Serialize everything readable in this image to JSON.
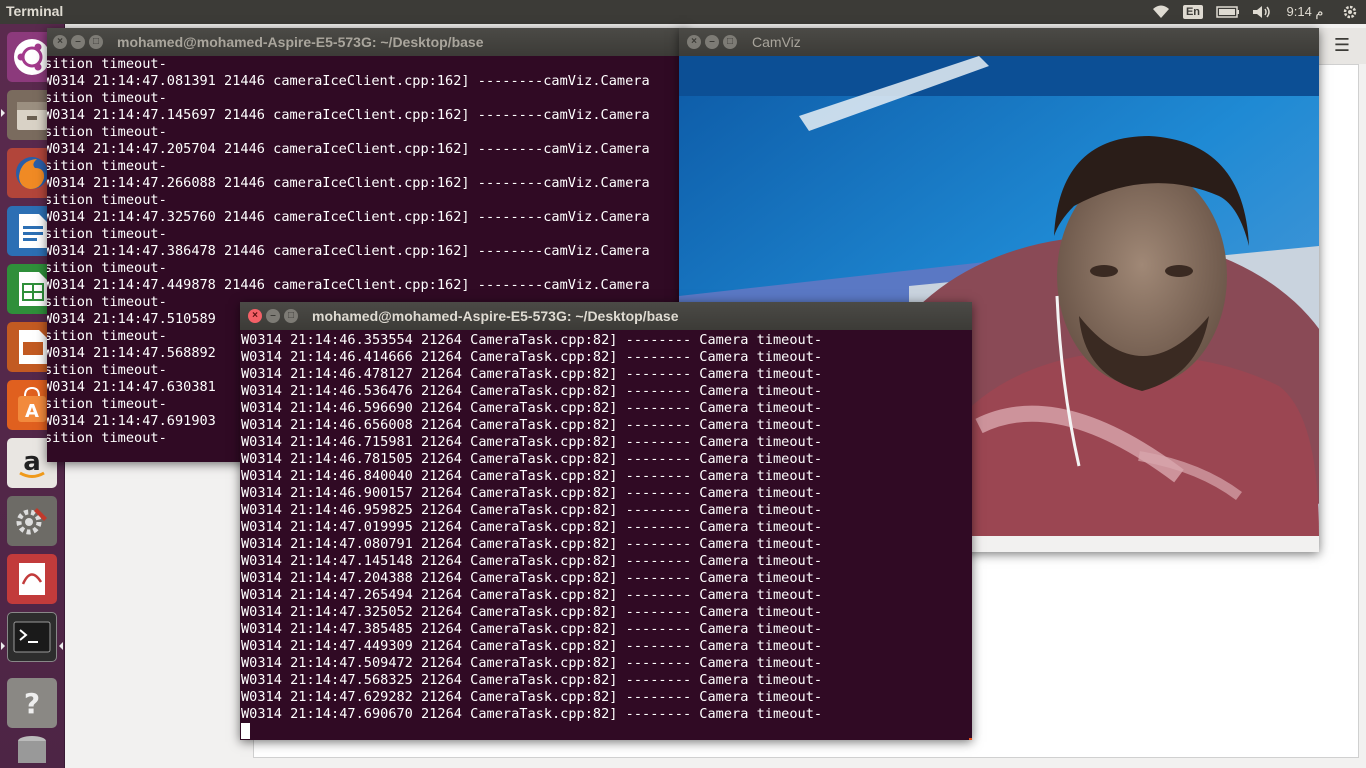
{
  "panel": {
    "title": "Terminal",
    "lang": "En",
    "clock": "9:14 م"
  },
  "launcher": {
    "items": [
      "ubuntu-dash",
      "files",
      "firefox",
      "libreoffice-writer",
      "libreoffice-calc",
      "libreoffice-impress",
      "ubuntu-software",
      "amazon",
      "system-settings",
      "document-viewer",
      "terminal",
      "help",
      "trash"
    ]
  },
  "back_terminal": {
    "title": "mohamed@mohamed-Aspire-E5-573G: ~/Desktop/base",
    "lines": [
      "sition timeout-",
      "W0314 21:14:47.081391 21446 cameraIceClient.cpp:162] --------camViz.Camera",
      "sition timeout-",
      "W0314 21:14:47.145697 21446 cameraIceClient.cpp:162] --------camViz.Camera",
      "sition timeout-",
      "W0314 21:14:47.205704 21446 cameraIceClient.cpp:162] --------camViz.Camera",
      "sition timeout-",
      "W0314 21:14:47.266088 21446 cameraIceClient.cpp:162] --------camViz.Camera",
      "sition timeout-",
      "W0314 21:14:47.325760 21446 cameraIceClient.cpp:162] --------camViz.Camera",
      "sition timeout-",
      "W0314 21:14:47.386478 21446 cameraIceClient.cpp:162] --------camViz.Camera",
      "sition timeout-",
      "W0314 21:14:47.449878 21446 cameraIceClient.cpp:162] --------camViz.Camera",
      "sition timeout-",
      "W0314 21:14:47.510589",
      "sition timeout-",
      "W0314 21:14:47.568892",
      "sition timeout-",
      "W0314 21:14:47.630381",
      "sition timeout-",
      "W0314 21:14:47.691903",
      "sition timeout-"
    ]
  },
  "front_terminal": {
    "title": "mohamed@mohamed-Aspire-E5-573G: ~/Desktop/base",
    "lines": [
      "W0314 21:14:46.353554 21264 CameraTask.cpp:82] -------- Camera timeout-",
      "W0314 21:14:46.414666 21264 CameraTask.cpp:82] -------- Camera timeout-",
      "W0314 21:14:46.478127 21264 CameraTask.cpp:82] -------- Camera timeout-",
      "W0314 21:14:46.536476 21264 CameraTask.cpp:82] -------- Camera timeout-",
      "W0314 21:14:46.596690 21264 CameraTask.cpp:82] -------- Camera timeout-",
      "W0314 21:14:46.656008 21264 CameraTask.cpp:82] -------- Camera timeout-",
      "W0314 21:14:46.715981 21264 CameraTask.cpp:82] -------- Camera timeout-",
      "W0314 21:14:46.781505 21264 CameraTask.cpp:82] -------- Camera timeout-",
      "W0314 21:14:46.840040 21264 CameraTask.cpp:82] -------- Camera timeout-",
      "W0314 21:14:46.900157 21264 CameraTask.cpp:82] -------- Camera timeout-",
      "W0314 21:14:46.959825 21264 CameraTask.cpp:82] -------- Camera timeout-",
      "W0314 21:14:47.019995 21264 CameraTask.cpp:82] -------- Camera timeout-",
      "W0314 21:14:47.080791 21264 CameraTask.cpp:82] -------- Camera timeout-",
      "W0314 21:14:47.145148 21264 CameraTask.cpp:82] -------- Camera timeout-",
      "W0314 21:14:47.204388 21264 CameraTask.cpp:82] -------- Camera timeout-",
      "W0314 21:14:47.265494 21264 CameraTask.cpp:82] -------- Camera timeout-",
      "W0314 21:14:47.325052 21264 CameraTask.cpp:82] -------- Camera timeout-",
      "W0314 21:14:47.385485 21264 CameraTask.cpp:82] -------- Camera timeout-",
      "W0314 21:14:47.449309 21264 CameraTask.cpp:82] -------- Camera timeout-",
      "W0314 21:14:47.509472 21264 CameraTask.cpp:82] -------- Camera timeout-",
      "W0314 21:14:47.568325 21264 CameraTask.cpp:82] -------- Camera timeout-",
      "W0314 21:14:47.629282 21264 CameraTask.cpp:82] -------- Camera timeout-",
      "W0314 21:14:47.690670 21264 CameraTask.cpp:82] -------- Camera timeout-"
    ]
  },
  "camviz": {
    "title": "CamViz"
  },
  "colors": {
    "terminal_bg": "#300a24",
    "panel_bg": "#3c3b37",
    "launcher_bg": "#5a2a4e",
    "accent": "#e95420"
  }
}
